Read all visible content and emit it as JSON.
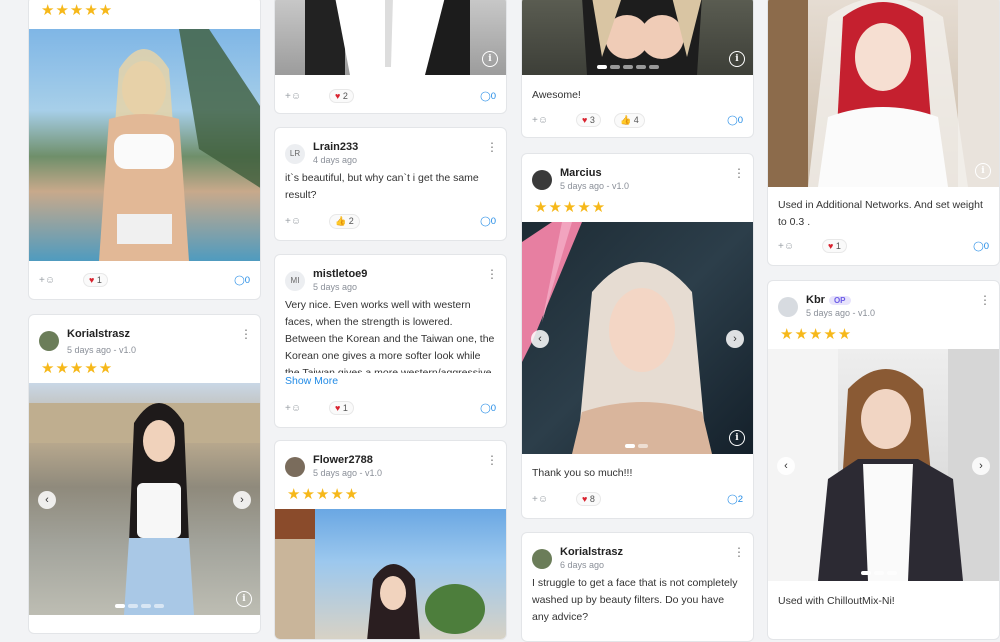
{
  "cards": {
    "c1a": {
      "stars": "★★★★★",
      "reactions": [
        {
          "icon": "heart",
          "count": "1"
        }
      ],
      "comments": "0"
    },
    "c1b": {
      "user": "Korialstrasz",
      "meta": "5 days ago - v1.0",
      "stars": "★★★★★"
    },
    "c2a": {
      "reactions": [
        {
          "icon": "heart",
          "count": "2"
        }
      ],
      "comments": "0"
    },
    "c2b": {
      "avatar_text": "LR",
      "user": "Lrain233",
      "meta": "4 days ago",
      "text": "it`s beautiful,  but why can`t i get the same result?",
      "reactions": [
        {
          "icon": "thumb",
          "count": "2"
        }
      ],
      "comments": "0"
    },
    "c2c": {
      "avatar_text": "MI",
      "user": "mistletoe9",
      "meta": "5 days ago",
      "text": "Very nice. Even works well with western faces, when the strength is lowered. Between the Korean and the Taiwan one, the Korean one gives a more softer look while the Taiwan gives a more western/aggressive",
      "show_more": "Show More",
      "reactions": [
        {
          "icon": "heart",
          "count": "1"
        }
      ],
      "comments": "0"
    },
    "c2d": {
      "user": "Flower2788",
      "meta": "5 days ago - v1.0",
      "stars": "★★★★★"
    },
    "c3a": {
      "text": "Awesome!",
      "reactions": [
        {
          "icon": "heart",
          "count": "3"
        },
        {
          "icon": "thumb",
          "count": "4"
        }
      ],
      "comments": "0"
    },
    "c3b": {
      "user": "Marcius",
      "meta": "5 days ago - v1.0",
      "stars": "★★★★★",
      "text": "Thank you so much!!!",
      "reactions": [
        {
          "icon": "heart",
          "count": "8"
        }
      ],
      "comments": "2"
    },
    "c3c": {
      "user": "Korialstrasz",
      "meta": "6 days ago",
      "text": "I struggle to get a face that is not completely washed up by beauty filters. Do you have any advice?"
    },
    "c4a": {
      "text": "Used in Additional Networks. And set weight to 0.3 .",
      "reactions": [
        {
          "icon": "heart",
          "count": "1"
        }
      ],
      "comments": "0"
    },
    "c4b": {
      "user": "Kbr",
      "badge": "OP",
      "meta": "5 days ago - v1.0",
      "stars": "★★★★★",
      "text": "Used with ChilloutMix-Ni!"
    }
  },
  "icons": {
    "add_reaction": "+☺",
    "heart": "♥",
    "thumb": "👍",
    "comment": "💬",
    "info": "i",
    "menu": "⋮",
    "prev": "‹",
    "next": "›"
  },
  "colors": {
    "heart": "#d9232f",
    "star": "#f6b81a",
    "link": "#228be6",
    "op_badge": "#6c5ce7"
  }
}
